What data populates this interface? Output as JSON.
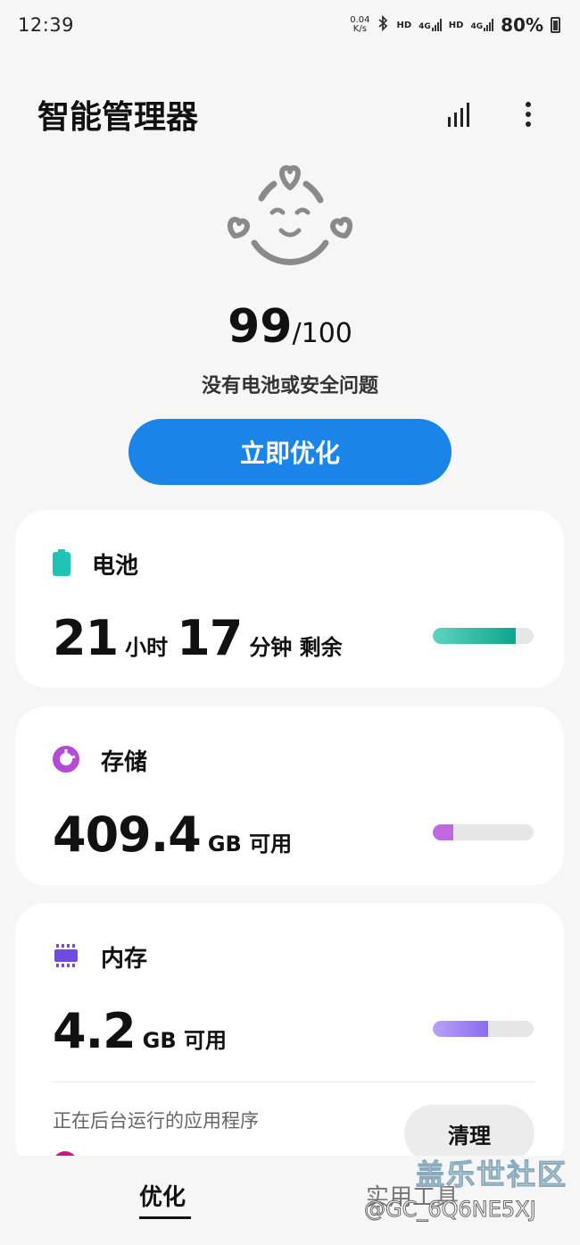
{
  "status_bar": {
    "time": "12:39",
    "net_speed_value": "0.04",
    "net_speed_unit": "K/s",
    "hd_1": "HD",
    "lte_1": "4G",
    "hd_2": "HD",
    "lte_2": "4G",
    "battery_percent": "80%"
  },
  "header": {
    "title": "智能管理器"
  },
  "score": {
    "value": "99",
    "total": "/100",
    "message": "没有电池或安全问题"
  },
  "optimize_button": "立即优化",
  "battery": {
    "label": "电池",
    "hours": "21",
    "hours_unit": "小时",
    "minutes": "17",
    "minutes_unit": "分钟 剩余",
    "level_fraction": 0.82,
    "icon_color": "#1fc4b4",
    "bar_color_start": "#5fd3c0",
    "bar_color_end": "#0ea58c"
  },
  "storage": {
    "label": "存储",
    "value": "409.4",
    "unit": "GB 可用",
    "used_fraction": 0.2,
    "icon_color": "#b44ad6",
    "bar_color": "#c069dd"
  },
  "memory": {
    "label": "内存",
    "value": "4.2",
    "unit": "GB 可用",
    "used_fraction": 0.55,
    "icon_color": "#6f4be0",
    "bar_color": "#8b6cf0",
    "running_apps_label": "正在后台运行的应用程序",
    "clean_button": "清理"
  },
  "bottom_nav": {
    "tab_optimize": "优化",
    "tab_tools": "实用工具"
  },
  "watermark": {
    "line1": "盖乐世社区",
    "line2": "@GC_6Q6NE5XJ"
  },
  "colors": {
    "accent": "#1a84e8",
    "background": "#f6f6f6"
  }
}
